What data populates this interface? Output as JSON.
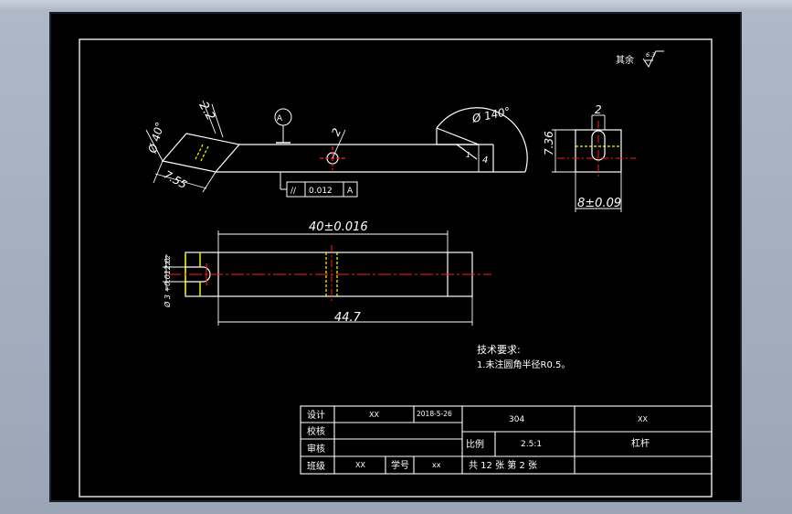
{
  "colors": {
    "background": "#000000",
    "line": "#ffffff",
    "centerline": "#ff2020",
    "hidden": "#ffff00",
    "outer_border": "#1a1f2b"
  },
  "surface_finish": {
    "label": "其余",
    "value": "6.3"
  },
  "front_view": {
    "dim_2_2": "2.2",
    "dim_phi40": "Ø 40°",
    "dim_7_55": "7.55",
    "datum": "A",
    "dim_2": "2",
    "dim_phi140": "Ø 140°",
    "dim_4": "4",
    "dim_1": "1",
    "tolerance": {
      "symbol": "//",
      "value": "0.012",
      "datum": "A"
    }
  },
  "side_view": {
    "dim_top": "2",
    "dim_left": "7.36",
    "dim_bottom": "8±0.09"
  },
  "top_view": {
    "dim_top": "40±0.016",
    "dim_bottom": "44.7",
    "dim_left_small": "2.2",
    "dim_left_tol": "Ø 3 +0.012 0"
  },
  "tech_requirements": {
    "title": "技术要求:",
    "items": [
      "1.未注圆角半径R0.5。"
    ]
  },
  "title_block": {
    "design_label": "设计",
    "design_name": "XX",
    "design_date": "2018-5-26",
    "check_label": "校核",
    "review_label": "审核",
    "class_label": "班级",
    "class_value": "XX",
    "student_no_label": "学号",
    "student_no_value": "xx",
    "material": "304",
    "school": "XX",
    "scale_label": "比例",
    "scale_value": "2.5:1",
    "part_name": "杠杆",
    "sheet_info": "共 12 张 第 2 张"
  }
}
